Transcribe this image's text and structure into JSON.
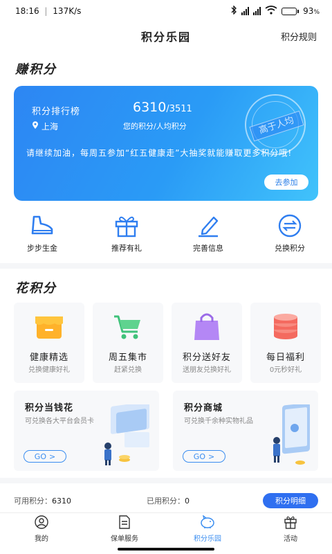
{
  "status": {
    "time": "18:16",
    "speed": "137K/s",
    "battery": "93"
  },
  "header": {
    "title": "积分乐园",
    "rules": "积分规则"
  },
  "earn": {
    "title": "赚积分",
    "banner": {
      "rank_label": "积分排行榜",
      "rank_value": "6310",
      "rank_total": "/3511",
      "location": "上海",
      "rank_desc": "您的积分/人均积分",
      "message": "请继续加油，每周五参加“红五健康走”大抽奖就能赚取更多积分哦!",
      "join": "去参加",
      "stamp": "高于人均"
    },
    "items": [
      {
        "label": "步步生金",
        "icon": "sneaker-icon"
      },
      {
        "label": "推荐有礼",
        "icon": "gift-icon"
      },
      {
        "label": "完善信息",
        "icon": "pencil-icon"
      },
      {
        "label": "兑换积分",
        "icon": "exchange-icon"
      }
    ]
  },
  "spend": {
    "title": "花积分",
    "cards": [
      {
        "title": "健康精选",
        "sub": "兑换健康好礼",
        "icon": "shop-icon"
      },
      {
        "title": "周五集市",
        "sub": "赶紧兑换",
        "icon": "cart-icon"
      },
      {
        "title": "积分送好友",
        "sub": "送朋友兑换好礼",
        "icon": "bag-icon"
      },
      {
        "title": "每日福利",
        "sub": "0元秒好礼",
        "icon": "coins-icon"
      }
    ],
    "promos": [
      {
        "title": "积分当钱花",
        "sub": "可兑换各大平台会员卡",
        "go": "GO"
      },
      {
        "title": "积分商城",
        "sub": "可兑换千余种实物礼品",
        "go": "GO"
      }
    ]
  },
  "points": {
    "available_label": "可用积分：",
    "available": "6310",
    "used_label": "已用积分：",
    "used": "0",
    "detail": "积分明细"
  },
  "tabs": [
    {
      "label": "我的",
      "icon": "person-icon",
      "active": false
    },
    {
      "label": "保单服务",
      "icon": "document-icon",
      "active": false
    },
    {
      "label": "积分乐园",
      "icon": "piggy-bank-icon",
      "active": true
    },
    {
      "label": "活动",
      "icon": "gift-box-icon",
      "active": false
    }
  ]
}
